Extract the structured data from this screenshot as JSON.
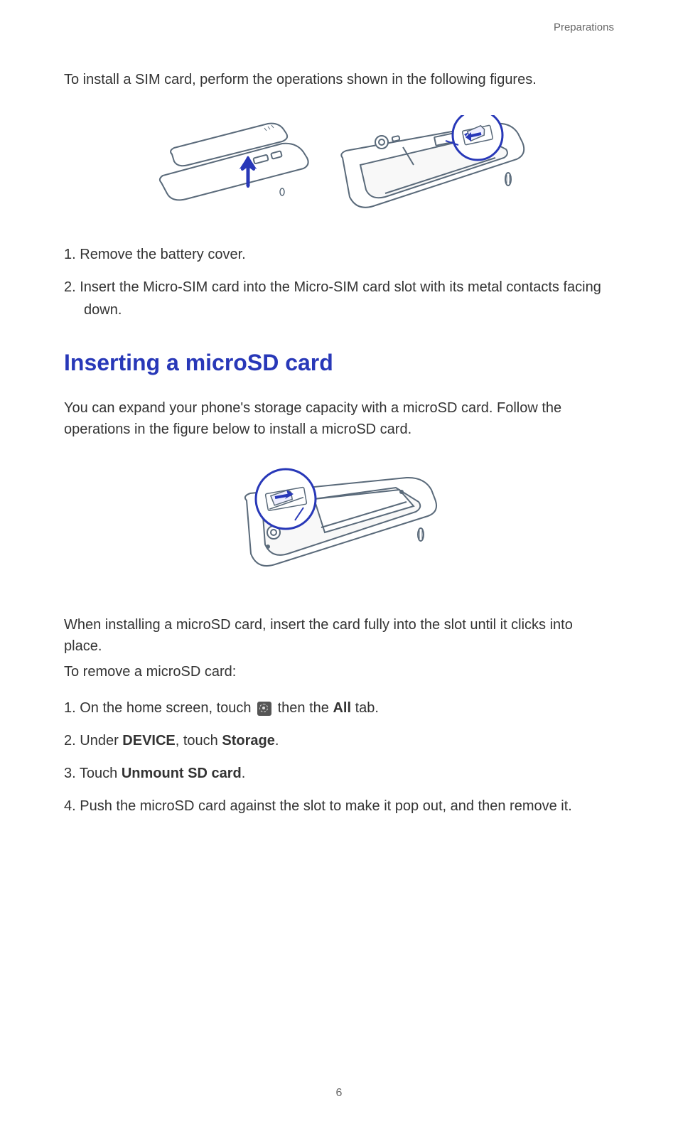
{
  "header": {
    "section": "Preparations"
  },
  "sim": {
    "intro": "To install a SIM card, perform the operations shown in the following figures.",
    "steps": {
      "s1_prefix": "1. ",
      "s1_text": "Remove the battery cover.",
      "s2_prefix": "2. ",
      "s2_text": "Insert the Micro-SIM card into the Micro-SIM card slot with its metal contacts facing down."
    }
  },
  "microsd": {
    "heading": "Inserting a microSD card",
    "intro": "You can expand your phone's storage capacity with a microSD card. Follow the operations in the figure below to install a microSD card.",
    "note1": "When installing a microSD card, insert the card fully into the slot until it clicks into place.",
    "note2": "To remove a microSD card:",
    "steps": {
      "s1_prefix": "1. ",
      "s1_a": "On the home screen, touch ",
      "s1_b": " then the ",
      "s1_all": "All",
      "s1_c": " tab.",
      "s2_prefix": "2. ",
      "s2_a": "Under ",
      "s2_device": "DEVICE",
      "s2_b": ", touch ",
      "s2_storage": "Storage",
      "s2_c": ".",
      "s3_prefix": "3. ",
      "s3_a": "Touch ",
      "s3_unmount": "Unmount SD card",
      "s3_b": ".",
      "s4_prefix": "4. ",
      "s4_text": "Push the microSD card against the slot to make it pop out, and then remove it."
    }
  },
  "page_number": "6"
}
